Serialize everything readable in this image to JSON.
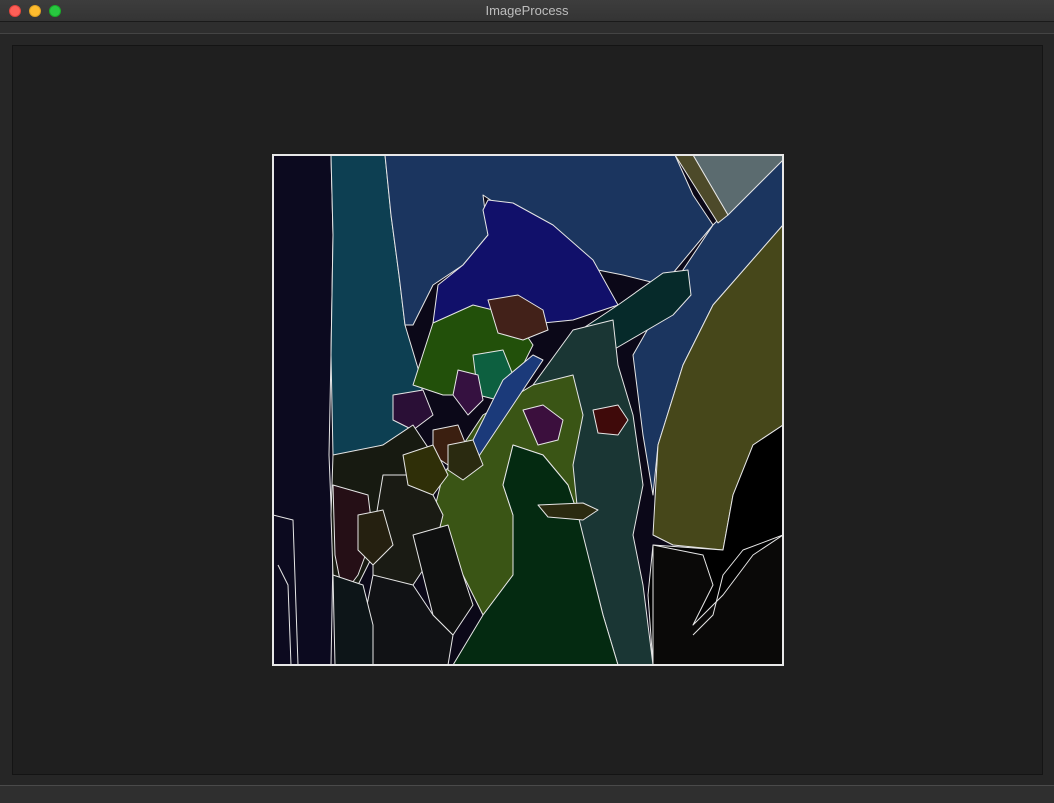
{
  "window": {
    "title": "ImageProcess"
  },
  "buttons": {
    "close": "close-icon",
    "minimize": "minimize-icon",
    "maximize": "maximize-icon"
  },
  "image": {
    "description_icon": "segmentation-result-image",
    "colors": {
      "outline": "#e6e6e6",
      "left_strip": "#0c0a1f",
      "teal_column": "#0d3f52",
      "background_blue": "#1b355f",
      "hat_top": "#11106a",
      "hat_brim": "#062a2a",
      "olive_right": "#46471a",
      "black_right": "#000000",
      "face_green": "#042a11",
      "face_light": "#3a5515",
      "cheek_teal": "#1a3634",
      "gray_corner": "#5b6b6f",
      "feather_dark": "#171a11"
    }
  }
}
